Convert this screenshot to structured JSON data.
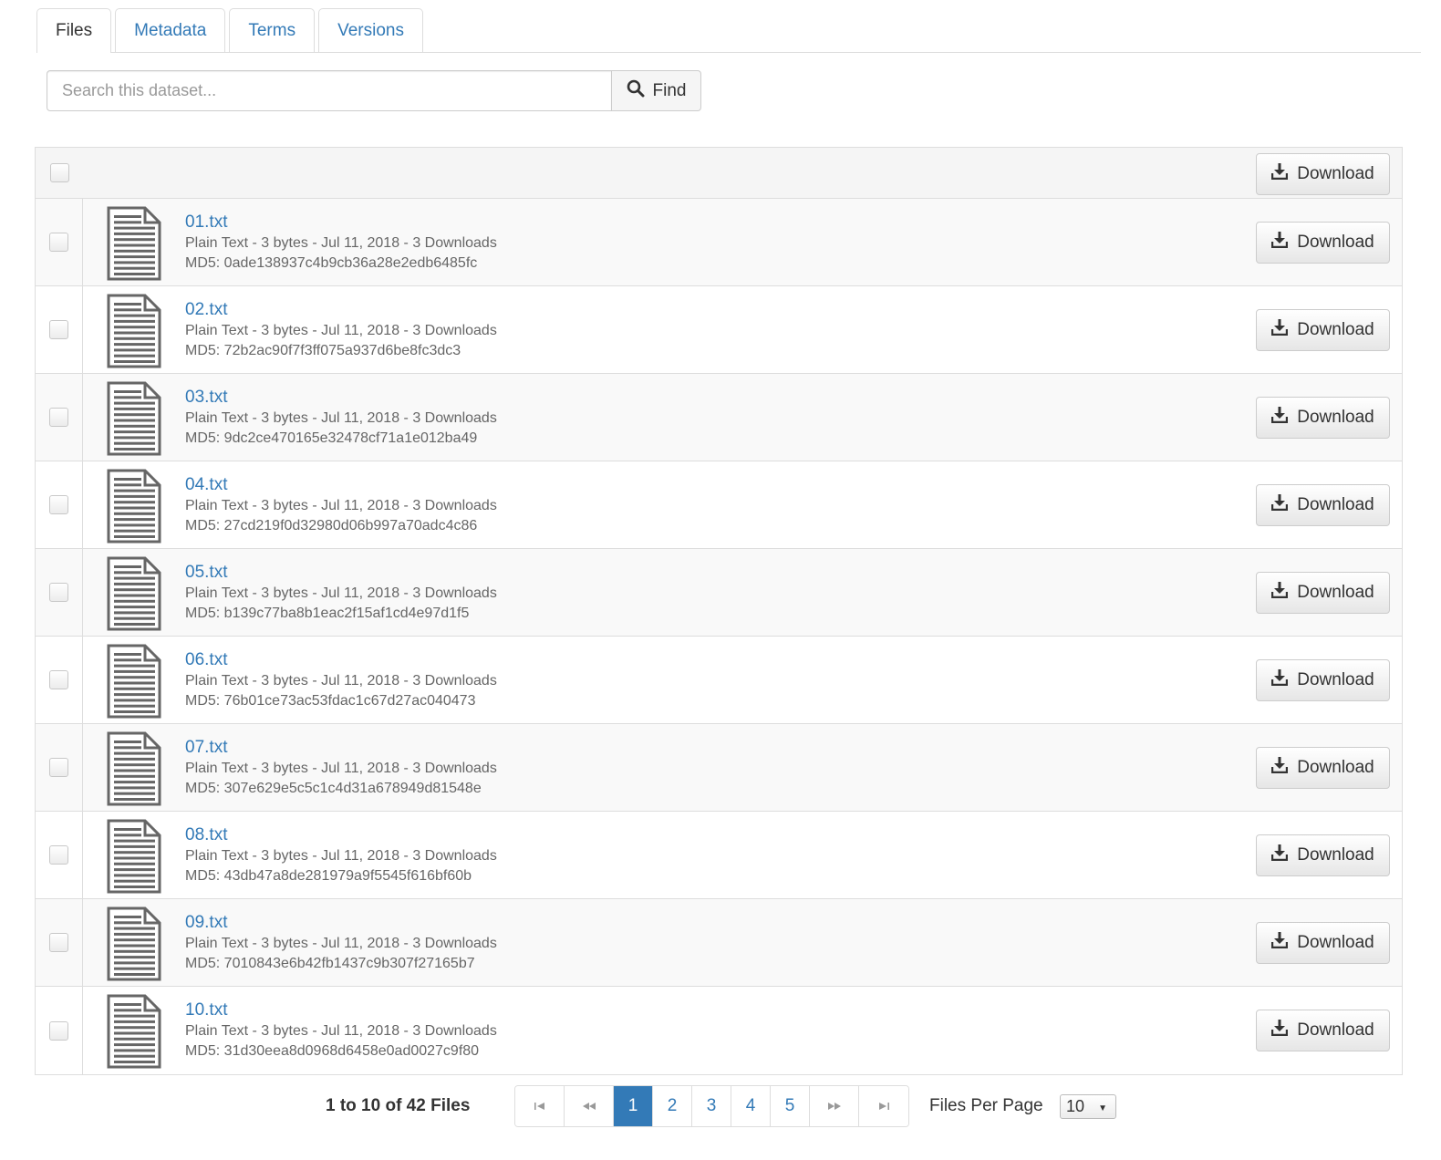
{
  "tabs": [
    {
      "label": "Files",
      "active": true
    },
    {
      "label": "Metadata",
      "active": false
    },
    {
      "label": "Terms",
      "active": false
    },
    {
      "label": "Versions",
      "active": false
    }
  ],
  "search": {
    "placeholder": "Search this dataset...",
    "button_label": "Find",
    "icon": "search-icon"
  },
  "table": {
    "header_download_label": "Download",
    "files": [
      {
        "name": "01.txt",
        "meta": "Plain Text - 3 bytes - Jul 11, 2018 - 3 Downloads",
        "md5": "MD5: 0ade138937c4b9cb36a28e2edb6485fc",
        "download_label": "Download"
      },
      {
        "name": "02.txt",
        "meta": "Plain Text - 3 bytes - Jul 11, 2018 - 3 Downloads",
        "md5": "MD5: 72b2ac90f7f3ff075a937d6be8fc3dc3",
        "download_label": "Download"
      },
      {
        "name": "03.txt",
        "meta": "Plain Text - 3 bytes - Jul 11, 2018 - 3 Downloads",
        "md5": "MD5: 9dc2ce470165e32478cf71a1e012ba49",
        "download_label": "Download"
      },
      {
        "name": "04.txt",
        "meta": "Plain Text - 3 bytes - Jul 11, 2018 - 3 Downloads",
        "md5": "MD5: 27cd219f0d32980d06b997a70adc4c86",
        "download_label": "Download"
      },
      {
        "name": "05.txt",
        "meta": "Plain Text - 3 bytes - Jul 11, 2018 - 3 Downloads",
        "md5": "MD5: b139c77ba8b1eac2f15af1cd4e97d1f5",
        "download_label": "Download"
      },
      {
        "name": "06.txt",
        "meta": "Plain Text - 3 bytes - Jul 11, 2018 - 3 Downloads",
        "md5": "MD5: 76b01ce73ac53fdac1c67d27ac040473",
        "download_label": "Download"
      },
      {
        "name": "07.txt",
        "meta": "Plain Text - 3 bytes - Jul 11, 2018 - 3 Downloads",
        "md5": "MD5: 307e629e5c5c1c4d31a678949d81548e",
        "download_label": "Download"
      },
      {
        "name": "08.txt",
        "meta": "Plain Text - 3 bytes - Jul 11, 2018 - 3 Downloads",
        "md5": "MD5: 43db47a8de281979a9f5545f616bf60b",
        "download_label": "Download"
      },
      {
        "name": "09.txt",
        "meta": "Plain Text - 3 bytes - Jul 11, 2018 - 3 Downloads",
        "md5": "MD5: 7010843e6b42fb1437c9b307f27165b7",
        "download_label": "Download"
      },
      {
        "name": "10.txt",
        "meta": "Plain Text - 3 bytes - Jul 11, 2018 - 3 Downloads",
        "md5": "MD5: 31d30eea8d0968d6458e0ad0027c9f80",
        "download_label": "Download"
      }
    ]
  },
  "pagination": {
    "count_text": "1 to 10 of 42 Files",
    "pages": [
      "1",
      "2",
      "3",
      "4",
      "5"
    ],
    "active_page": "1",
    "first_icon": "⇤",
    "prev_icon": "«",
    "next_icon": "»",
    "last_icon": "⇥",
    "per_page_label": "Files Per Page",
    "per_page_value": "10"
  },
  "colors": {
    "link": "#337ab7",
    "active_page_bg": "#337ab7",
    "row_alt": "#f9f9f9",
    "header_bg": "#f5f5f5"
  }
}
